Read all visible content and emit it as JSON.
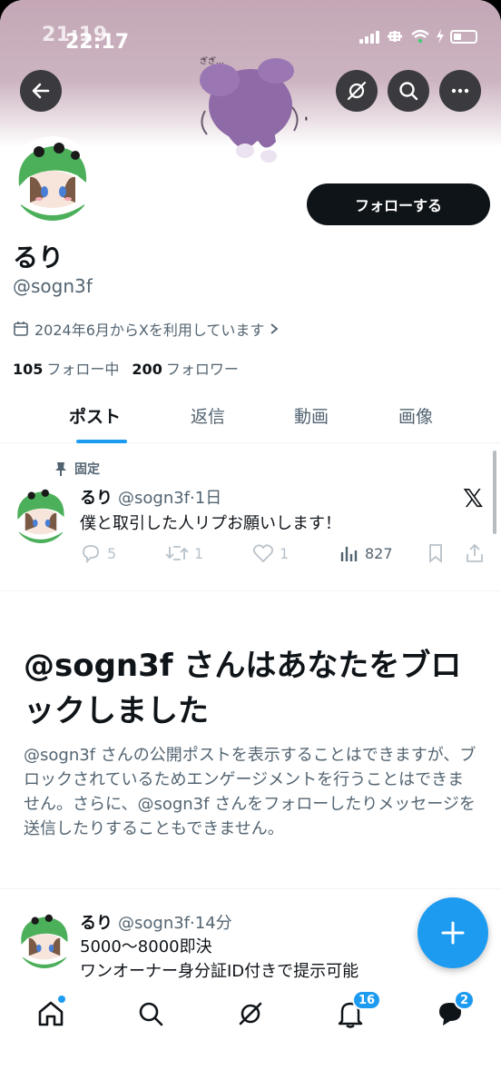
{
  "status_bar": {
    "time_back": "21:19",
    "time_front": "22:17"
  },
  "profile": {
    "display_name": "るり",
    "handle": "@sogn3f",
    "joined": "2024年6月からXを利用しています",
    "following_count": "105",
    "following_label": "フォロー中",
    "followers_count": "200",
    "followers_label": "フォロワー",
    "follow_button": "フォローする"
  },
  "tabs": [
    {
      "label": "ポスト",
      "active": true
    },
    {
      "label": "返信",
      "active": false
    },
    {
      "label": "動画",
      "active": false
    },
    {
      "label": "画像",
      "active": false
    }
  ],
  "pinned_post": {
    "pinned_label": "固定",
    "name": "るり",
    "meta": "@sogn3f·1日",
    "text": "僕と取引した人リプお願いします！",
    "replies": "5",
    "reposts": "1",
    "likes": "1",
    "views": "827"
  },
  "blocked_notice": {
    "title": "@sogn3f さんはあなたをブロックしました",
    "body": "@sogn3f さんの公開ポストを表示することはできますが、ブロックされているためエンゲージメントを行うことはできません。さらに、@sogn3f さんをフォローしたりメッセージを送信したりすることもできません。"
  },
  "second_post": {
    "name": "るり",
    "meta": "@sogn3f·14分",
    "line1": "5000〜8000即決",
    "line2": "ワンオーナー身分証ID付きで提示可能"
  },
  "bottom_nav": {
    "notifications_badge": "16",
    "messages_badge": "2"
  },
  "colors": {
    "accent": "#1d9bf0",
    "text": "#0f1419",
    "muted": "#536471",
    "banner": "#c3a7b6"
  }
}
